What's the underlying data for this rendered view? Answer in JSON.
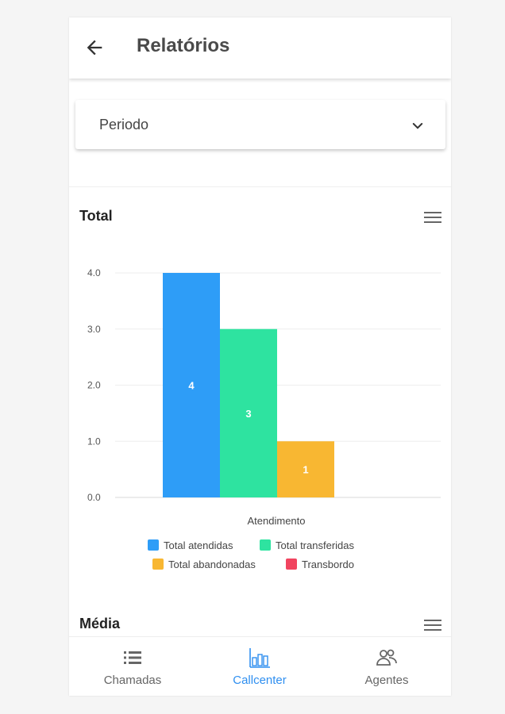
{
  "header": {
    "title": "Relatórios",
    "back_icon": "arrow-left-icon"
  },
  "filter": {
    "label": "Periodo",
    "icon": "chevron-down-icon"
  },
  "sections": {
    "total": {
      "title": "Total",
      "menu_icon": "hamburger-menu-icon"
    },
    "media": {
      "title": "Média",
      "menu_icon": "hamburger-menu-icon"
    }
  },
  "chart_data": {
    "type": "bar",
    "title": "Total",
    "categories": [
      "Atendimento"
    ],
    "xlabel": "Atendimento",
    "ylabel": "",
    "ylim": [
      0,
      4
    ],
    "y_ticks": [
      "0.0",
      "1.0",
      "2.0",
      "3.0",
      "4.0"
    ],
    "grid": true,
    "legend_position": "bottom",
    "series": [
      {
        "name": "Total atendidas",
        "values": [
          4
        ],
        "color": "#2e9df7"
      },
      {
        "name": "Total transferidas",
        "values": [
          3
        ],
        "color": "#2ee3a0"
      },
      {
        "name": "Total abandonadas",
        "values": [
          1
        ],
        "color": "#f8b732"
      },
      {
        "name": "Transbordo",
        "values": [
          0
        ],
        "color": "#f1445f"
      }
    ]
  },
  "tabs": [
    {
      "label": "Chamadas",
      "icon": "list-icon",
      "active": false
    },
    {
      "label": "Callcenter",
      "icon": "bar-chart-icon",
      "active": true
    },
    {
      "label": "Agentes",
      "icon": "people-icon",
      "active": false
    }
  ],
  "colors": {
    "accent": "#2f8ff0",
    "text_muted": "#666666"
  }
}
